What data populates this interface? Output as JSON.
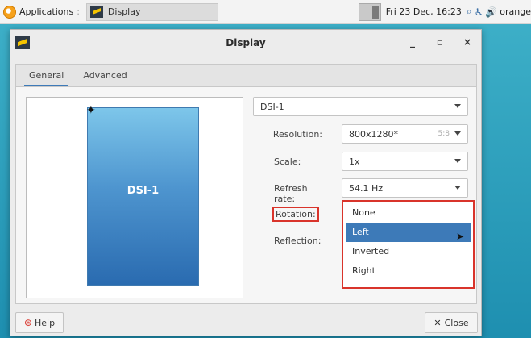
{
  "panel": {
    "apps_label": "Applications",
    "separator": ":",
    "task_label": "Display",
    "clock": "Fri 23 Dec, 16:23",
    "user": "orange"
  },
  "window": {
    "title": "Display",
    "minimize": "_",
    "maximize": "▫",
    "close": "×"
  },
  "tabs": [
    {
      "label": "General",
      "active": true
    },
    {
      "label": "Advanced",
      "active": false
    }
  ],
  "preview": {
    "monitor_label": "DSI-1"
  },
  "settings": {
    "display_select": "DSI-1",
    "resolution_label": "Resolution:",
    "resolution_value": "800x1280*",
    "resolution_ratio": "5:8",
    "scale_label": "Scale:",
    "scale_value": "1x",
    "refresh_label": "Refresh rate:",
    "refresh_value": "54.1 Hz",
    "rotation_label": "Rotation:",
    "reflection_label": "Reflection:"
  },
  "rotation_options": [
    {
      "label": "None",
      "selected": false
    },
    {
      "label": "Left",
      "selected": true
    },
    {
      "label": "Inverted",
      "selected": false
    },
    {
      "label": "Right",
      "selected": false
    }
  ],
  "buttons": {
    "help": "Help",
    "close": "Close"
  },
  "colors": {
    "accent": "#3d7ab8",
    "highlight_box": "#d9342b"
  }
}
